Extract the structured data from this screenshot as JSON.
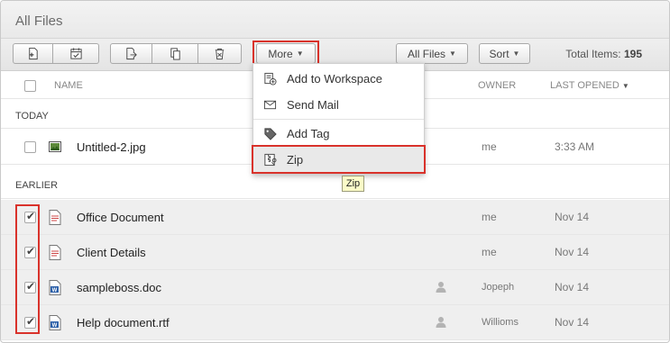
{
  "window": {
    "title": "All Files"
  },
  "toolbar": {
    "more_label": "More",
    "all_files_label": "All Files",
    "sort_label": "Sort",
    "total_label": "Total Items:",
    "total_value": "195"
  },
  "columns": {
    "name": "NAME",
    "owner": "OWNER",
    "last_opened": "LAST OPENED"
  },
  "sections": {
    "today": "TODAY",
    "earlier": "EARLIER"
  },
  "rows": [
    {
      "name": "Untitled-2.jpg",
      "owner": "me",
      "opened": "3:33 AM",
      "type": "image",
      "checked": false
    },
    {
      "name": "Office Document",
      "owner": "me",
      "opened": "Nov 14",
      "type": "document",
      "checked": true
    },
    {
      "name": "Client Details",
      "owner": "me",
      "opened": "Nov 14",
      "type": "document",
      "checked": true
    },
    {
      "name": "sampleboss.doc",
      "owner": "Jopeph",
      "opened": "Nov 14",
      "type": "word",
      "checked": true
    },
    {
      "name": "Help document.rtf",
      "owner": "Willioms",
      "opened": "Nov 14",
      "type": "word",
      "checked": true
    }
  ],
  "menu": {
    "items": [
      {
        "label": "Add to Workspace",
        "icon": "add-to-workspace-icon"
      },
      {
        "label": "Send Mail",
        "icon": "mail-icon"
      },
      {
        "label": "Add Tag",
        "icon": "tag-icon"
      },
      {
        "label": "Zip",
        "icon": "zip-icon"
      }
    ]
  },
  "tooltip": {
    "text": "Zip"
  },
  "colors": {
    "highlight": "#d9322b",
    "tooltip_bg": "#fbfcc8",
    "selected_row": "#efefef"
  }
}
